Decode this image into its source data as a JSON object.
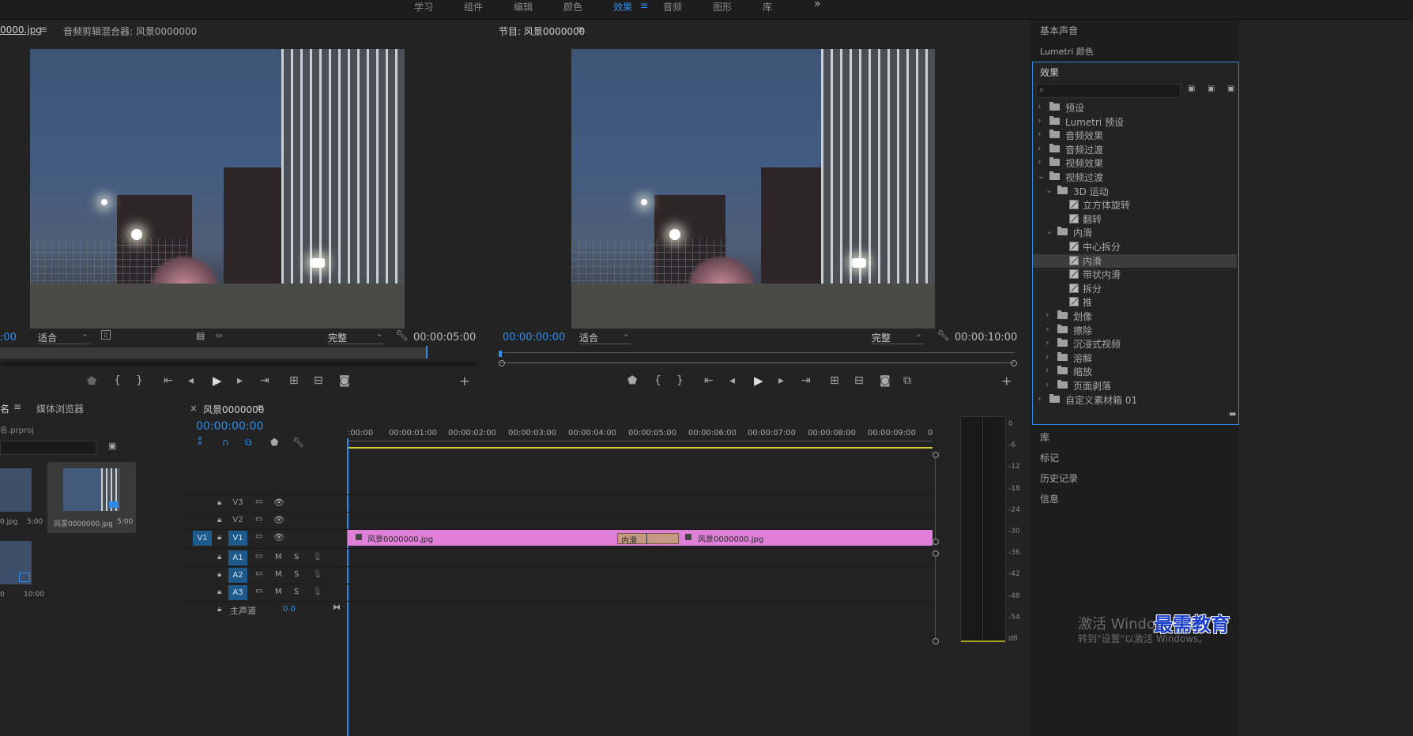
{
  "workspace_tabs": [
    "学习",
    "组件",
    "编辑",
    "颜色",
    "效果",
    "音频",
    "图形",
    "库"
  ],
  "active_workspace": "效果",
  "more_label": "»",
  "source": {
    "tab_label": "0000.jpg",
    "tab_menu": "≡",
    "audio_mixer_tab": "音频剪辑混合器: 风景0000000",
    "timecode_left": ":00",
    "fit": "适合",
    "quality": "完整",
    "duration": "00:00:05:00"
  },
  "program": {
    "tab_label": "节目: 风景0000000",
    "tab_menu": "≡",
    "timecode": "00:00:00:00",
    "fit": "适合",
    "quality": "完整",
    "duration": "00:00:10:00"
  },
  "effects_panel": {
    "basic_sound": "基本声音",
    "lumetri_color": "Lumetri 颜色",
    "title": "效果",
    "search_placeholder": "",
    "tree": [
      {
        "label": "预设",
        "type": "folder-special",
        "depth": 0,
        "state": "closed"
      },
      {
        "label": "Lumetri 预设",
        "type": "folder-special",
        "depth": 0,
        "state": "closed"
      },
      {
        "label": "音频效果",
        "type": "folder",
        "depth": 0,
        "state": "closed"
      },
      {
        "label": "音频过渡",
        "type": "folder",
        "depth": 0,
        "state": "closed"
      },
      {
        "label": "视频效果",
        "type": "folder",
        "depth": 0,
        "state": "closed"
      },
      {
        "label": "视频过渡",
        "type": "folder",
        "depth": 0,
        "state": "open"
      },
      {
        "label": "3D 运动",
        "type": "folder",
        "depth": 1,
        "state": "open"
      },
      {
        "label": "立方体旋转",
        "type": "fx",
        "depth": 2,
        "state": "none"
      },
      {
        "label": "翻转",
        "type": "fx",
        "depth": 2,
        "state": "none"
      },
      {
        "label": "内滑",
        "type": "folder",
        "depth": 1,
        "state": "open"
      },
      {
        "label": "中心拆分",
        "type": "fx",
        "depth": 2,
        "state": "none"
      },
      {
        "label": "内滑",
        "type": "fx",
        "depth": 2,
        "state": "selected"
      },
      {
        "label": "带状内滑",
        "type": "fx",
        "depth": 2,
        "state": "none"
      },
      {
        "label": "拆分",
        "type": "fx",
        "depth": 2,
        "state": "none"
      },
      {
        "label": "推",
        "type": "fx",
        "depth": 2,
        "state": "none"
      },
      {
        "label": "划像",
        "type": "folder",
        "depth": 1,
        "state": "closed"
      },
      {
        "label": "擦除",
        "type": "folder",
        "depth": 1,
        "state": "closed"
      },
      {
        "label": "沉浸式视频",
        "type": "folder",
        "depth": 1,
        "state": "closed"
      },
      {
        "label": "溶解",
        "type": "folder",
        "depth": 1,
        "state": "closed"
      },
      {
        "label": "缩放",
        "type": "folder",
        "depth": 1,
        "state": "closed"
      },
      {
        "label": "页面剥落",
        "type": "folder",
        "depth": 1,
        "state": "closed"
      },
      {
        "label": "自定义素材箱 01",
        "type": "folder",
        "depth": 0,
        "state": "closed"
      }
    ],
    "library": "库",
    "markers": "标记",
    "history": "历史记录",
    "info": "信息"
  },
  "project": {
    "tab_name": "名",
    "tab_menu": "≡",
    "media_browser": "媒体浏览器",
    "project_file": "名.prproj",
    "items": [
      {
        "name": "0.jpg",
        "duration": "5:00"
      },
      {
        "name": "风景0000000.jpg",
        "duration": "5:00"
      },
      {
        "name": "0",
        "duration": "10:00"
      }
    ]
  },
  "timeline": {
    "close": "×",
    "sequence_name": "风景0000000",
    "menu": "≡",
    "timecode": "00:00:00:00",
    "ruler": [
      ":00:00",
      "00:00:01:00",
      "00:00:02:00",
      "00:00:03:00",
      "00:00:04:00",
      "00:00:05:00",
      "00:00:06:00",
      "00:00:07:00",
      "00:00:08:00",
      "00:00:09:00",
      "0"
    ],
    "video_tracks": [
      "V3",
      "V2",
      "V1"
    ],
    "source_patch": "V1",
    "audio_tracks": [
      "A1",
      "A2",
      "A3"
    ],
    "mute": "M",
    "solo": "S",
    "master_label": "主声道",
    "master_value": "0.0",
    "clip_left": "风景0000000.jpg",
    "clip_right": "风景0000000.jpg",
    "transition": "内滑"
  },
  "meter_scale": [
    "0",
    "-6",
    "-12",
    "-18",
    "-24",
    "-30",
    "-36",
    "-42",
    "-48",
    "-54",
    "dB"
  ],
  "watermark": {
    "line1": "激活 Windo",
    "line2": "转到\"设置\"以激活 Windows。",
    "brand": "最需教育"
  }
}
